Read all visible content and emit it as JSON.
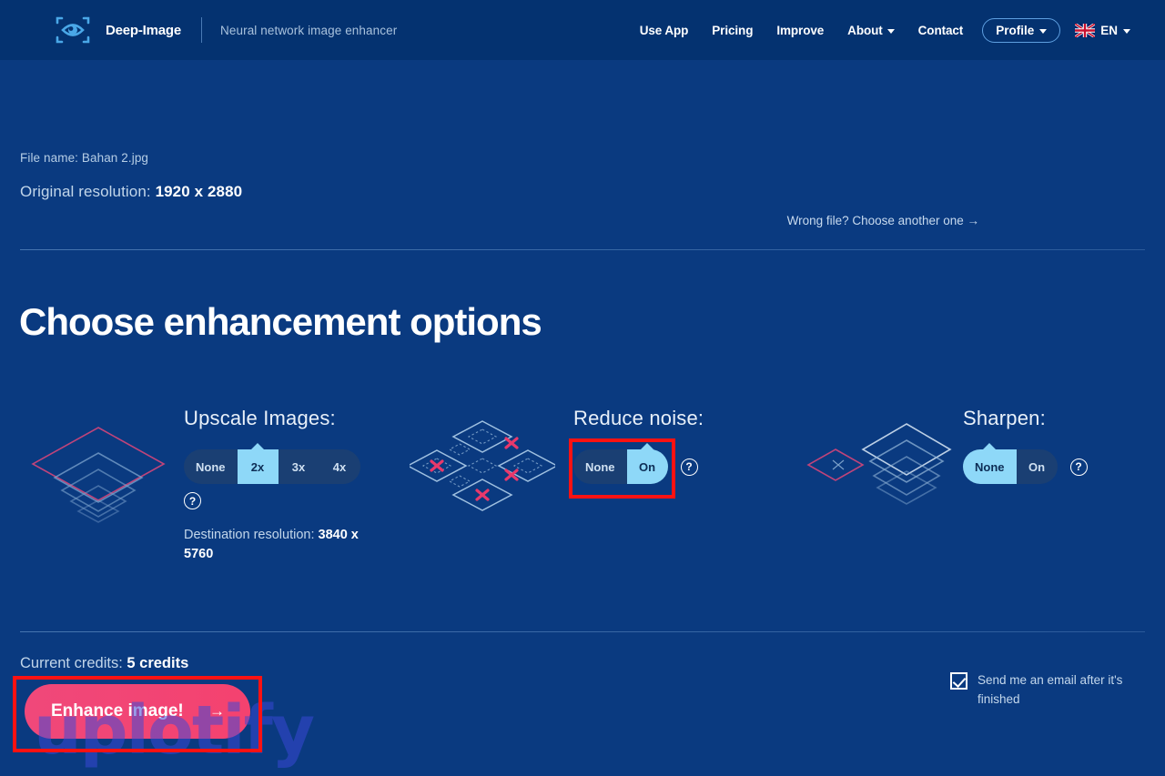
{
  "header": {
    "logo_icon": "eye-scan-logo-icon",
    "brand_name": "Deep-Image",
    "tagline": "Neural network image enhancer",
    "nav": [
      {
        "label": "Use App",
        "has_caret": false
      },
      {
        "label": "Pricing",
        "has_caret": false
      },
      {
        "label": "Improve",
        "has_caret": false
      },
      {
        "label": "About",
        "has_caret": true
      },
      {
        "label": "Contact",
        "has_caret": false
      }
    ],
    "profile_label": "Profile",
    "language_label": "EN",
    "flag_icon": "uk-flag-icon"
  },
  "file_info": {
    "file_name_label": "File name: Bahan 2.jpg",
    "original_resolution_label": "Original resolution:",
    "original_resolution_value": "1920 x 2880",
    "wrong_file_link": "Wrong file? Choose another one →"
  },
  "main": {
    "title": "Choose enhancement options",
    "options": [
      {
        "name": "upscale",
        "label": "Upscale Images:",
        "choices": [
          "None",
          "2x",
          "3x",
          "4x"
        ],
        "selected": "2x",
        "help_icon": "question-circle-icon",
        "destination_resolution_label": "Destination resolution:",
        "destination_resolution_value": "3840 x 5760"
      },
      {
        "name": "reduce-noise",
        "label": "Reduce noise:",
        "choices": [
          "None",
          "On"
        ],
        "selected": "On",
        "help_icon": "question-circle-icon"
      },
      {
        "name": "sharpen",
        "label": "Sharpen:",
        "choices": [
          "None",
          "On"
        ],
        "selected": "None",
        "help_icon": "question-circle-icon"
      }
    ]
  },
  "footer": {
    "credits_label": "Current credits:",
    "credits_value": "5 credits",
    "enhance_button_label": "Enhance image!",
    "enhance_button_arrow": "→",
    "email_checkbox_label": "Send me an email after it's finished",
    "email_checked": true
  },
  "watermark": "uplotify",
  "colors": {
    "header_bg": "#043270",
    "body_bg": "#0a3a80",
    "accent_cyan": "#8ed8f8",
    "accent_pink": "#f0487a",
    "annotation_red": "#fc1212",
    "segment_bg": "#1a3f73"
  }
}
